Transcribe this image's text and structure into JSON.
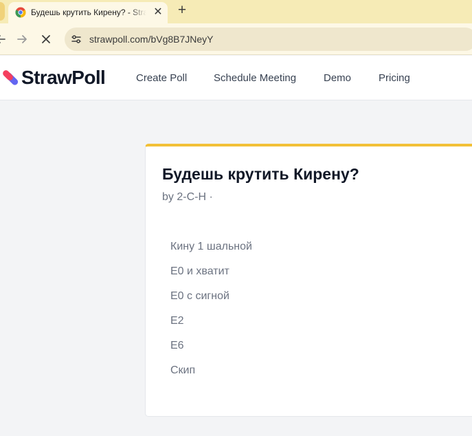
{
  "browser": {
    "tab": {
      "title": "Будешь крутить Кирену? - StrawPoll",
      "close_glyph": "✕"
    },
    "new_tab_glyph": "+",
    "url": "strawpoll.com/bVg8B7JNeyY"
  },
  "site": {
    "logo_text": "StrawPoll",
    "nav": {
      "create_poll": "Create Poll",
      "schedule_meeting": "Schedule Meeting",
      "demo": "Demo",
      "pricing": "Pricing"
    }
  },
  "poll": {
    "title": "Будешь крутить Кирену?",
    "meta": "by 2-C-H ·",
    "options": [
      "Кину 1 шальной",
      "E0 и хватит",
      "E0 с сигной",
      "E2",
      "E6",
      "Скип"
    ]
  },
  "colors": {
    "accent_yellow": "#f2c037",
    "logo_pink": "#f43f5e",
    "logo_violet": "#6366f1",
    "tab_strip": "#f6ebb6"
  },
  "icons": [
    "chrome-favicon",
    "close-icon",
    "plus-icon",
    "back-arrow-icon",
    "forward-arrow-icon",
    "stop-icon",
    "site-info-icon",
    "strawpoll-logo-mark"
  ]
}
